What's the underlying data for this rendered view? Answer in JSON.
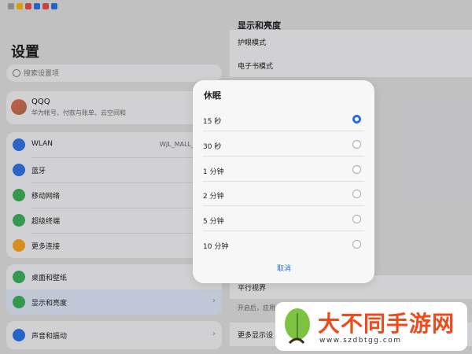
{
  "left_panel": {
    "title": "设置",
    "search_placeholder": "搜索设置项",
    "account": {
      "name": "QQQ",
      "subtitle": "华为帐号、付款与账单、云空间和"
    },
    "group1": [
      {
        "label": "WLAN",
        "value": "WJL_MALL_",
        "icon": "wifi-icon",
        "color": "#2d6fe0"
      },
      {
        "label": "蓝牙",
        "value": "",
        "icon": "bluetooth-icon",
        "color": "#2d6fe0"
      },
      {
        "label": "移动网络",
        "value": "",
        "icon": "signal-icon",
        "color": "#3aaa57"
      },
      {
        "label": "超级终端",
        "value": "",
        "icon": "super-device-icon",
        "color": "#3aaa57"
      },
      {
        "label": "更多连接",
        "value": "",
        "icon": "link-icon",
        "color": "#f0a020"
      }
    ],
    "group2": [
      {
        "label": "桌面和壁纸",
        "icon": "wallpaper-icon",
        "color": "#3aaa57"
      },
      {
        "label": "显示和亮度",
        "icon": "eye-icon",
        "color": "#3aaa57"
      }
    ],
    "group3": [
      {
        "label": "声音和振动",
        "icon": "sound-icon",
        "color": "#2d6fe0"
      }
    ]
  },
  "right_panel": {
    "title": "显示和亮度",
    "rows": [
      "护眼模式",
      "电子书模式",
      "平行视界",
      "开启后，应用",
      "更多显示设"
    ]
  },
  "dialog": {
    "title": "休眠",
    "options": [
      "15 秒",
      "30 秒",
      "1 分钟",
      "2 分钟",
      "5 分钟",
      "10 分钟"
    ],
    "selected_index": 0,
    "cancel_label": "取消",
    "accent": "#2a6fd6"
  },
  "watermark": {
    "brand": "大不同手游网",
    "url": "www.szdbtgg.com"
  }
}
